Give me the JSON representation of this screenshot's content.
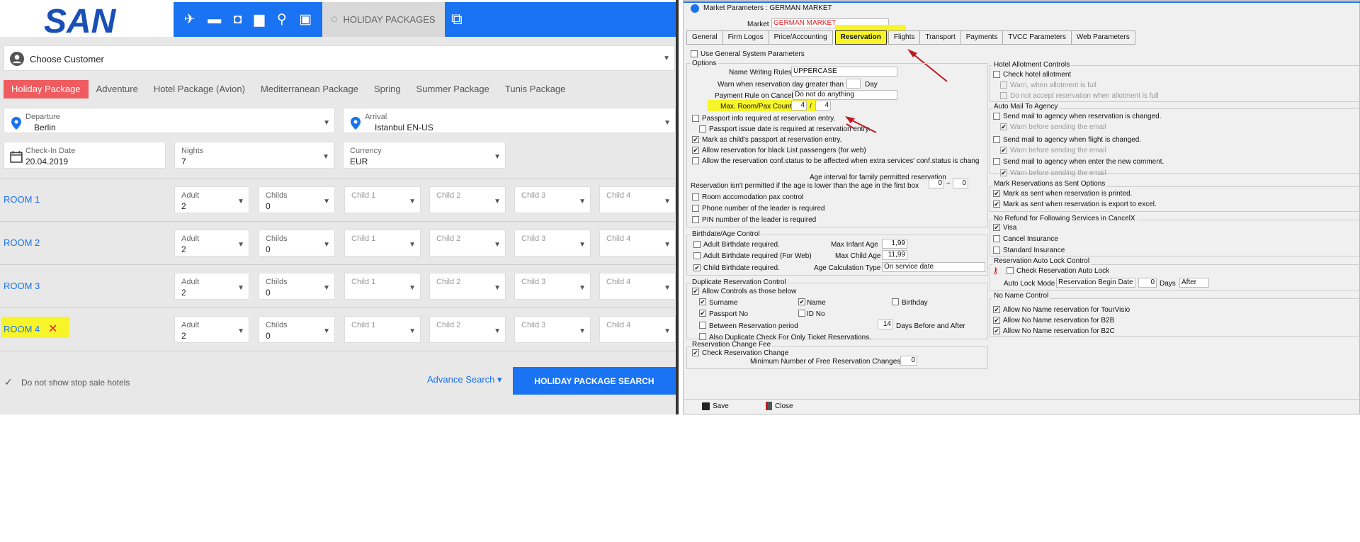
{
  "topnav": {
    "logo_text": "SAN",
    "icons": [
      "plane-icon",
      "bed-icon",
      "bag-icon",
      "car-icon",
      "person-walking-icon",
      "bus-icon"
    ],
    "package_tab_label": "HOLIDAY PACKAGES"
  },
  "customer": {
    "label": "Choose Customer"
  },
  "tabs": [
    "Holiday Package",
    "Adventure",
    "Hotel Package (Avion)",
    "Mediterranean Package",
    "Spring",
    "Summer Package",
    "Tunis Package"
  ],
  "departure": {
    "label": "Departure",
    "value": "Berlin"
  },
  "arrival": {
    "label": "Arrival",
    "value": "Istanbul EN-US"
  },
  "checkin": {
    "label": "Check-In Date",
    "value": "20.04.2019"
  },
  "nights": {
    "label": "Nights",
    "value": "7"
  },
  "currency": {
    "label": "Currency",
    "value": "EUR"
  },
  "rooms": [
    {
      "label": "ROOM 1",
      "adult": "2",
      "childs": "0"
    },
    {
      "label": "ROOM 2",
      "adult": "2",
      "childs": "0"
    },
    {
      "label": "ROOM 3",
      "adult": "2",
      "childs": "0"
    },
    {
      "label": "ROOM 4",
      "adult": "2",
      "childs": "0"
    }
  ],
  "room_field_labels": {
    "adult": "Adult",
    "childs": "Childs",
    "child1": "Child 1",
    "child2": "Child 2",
    "child3": "Child 3",
    "child4": "Child 4"
  },
  "stop_sale_label": "Do not show stop sale hotels",
  "advance_search_label": "Advance Search",
  "search_button_label": "HOLIDAY PACKAGE SEARCH",
  "dialog": {
    "title": "Market Parameters : GERMAN MARKET",
    "market_label": "Market",
    "market_value": "GERMAN MARKET",
    "tabs": [
      "General",
      "Firm Logos",
      "Price/Accounting",
      "Reservation",
      "Flights",
      "Transport",
      "Payments",
      "TVCC Parameters",
      "Web Parameters"
    ],
    "use_general": "Use General System Parameters",
    "options": {
      "title": "Options",
      "name_writing_rules_label": "Name Writing Rules",
      "name_writing_rules_value": "UPPERCASE",
      "warn_day_label": "Warn when reservation day greater than :",
      "warn_day_unit": "Day",
      "payment_rule_label": "Payment Rule on Cancel",
      "payment_rule_value": "Do not do anything",
      "max_room_label": "Max. Room/Pax Count",
      "max_room_value": "4",
      "max_pax_value": "4",
      "max_sep": "/",
      "passport_info": "Passport info required at reservation  entry.",
      "passport_issue": "Passport issue date is required at reservation  entry.",
      "child_passport": "Mark as child's passport at reservation  entry.",
      "black_list": "Allow reservation for black List passengers (for web)",
      "conf_status": "Allow the reservation conf.status to be affected when extra services' conf.status is chang",
      "age_interval_label": "Age interval for family permitted reservation",
      "age_interval_note": "Reservation isn't permitted if the age is lower than the age in the first box",
      "age_from": "0",
      "age_to": "0",
      "age_sep": "~",
      "room_accom": "Room accomodation pax control",
      "phone_leader": "Phone number of the leader is required",
      "pin_leader": "PIN number of the leader is required"
    },
    "birthdate": {
      "title": "Birthdate/Age Control",
      "adult_required": "Adult Birthdate required.",
      "adult_web": "Adult Birthdate required (For Web)",
      "child_required": "Child Birthdate required.",
      "max_infant_label": "Max Infant Age",
      "max_infant_value": "1,99",
      "max_child_label": "Max Child Age",
      "max_child_value": "11,99",
      "calc_type_label": "Age Calculation Type",
      "calc_type_value": "On service date"
    },
    "duplicate": {
      "title": "Duplicate Reservation Control",
      "allow_controls": "Allow Controls as those below",
      "surname": "Surname",
      "name": "Name",
      "birthday": "Birthday",
      "passport_no": "Passport No",
      "id_no": "ID No",
      "between": "Between Reservation period",
      "days_value": "14",
      "days_label": "Days Before and After",
      "also_dup": "Also Duplicate Check For Only Ticket Reservations."
    },
    "change_fee": {
      "title": "Reservation Change Fee",
      "check": "Check Reservation Change",
      "min_free_label": "Minimum Number of Free Reservation Changes",
      "min_free_value": "0"
    },
    "hotel_allot": {
      "title": "Hotel Allotment Controls",
      "check": "Check hotel allotment",
      "warn_full": "Warn, when allotment is full",
      "no_accept": "Do not accept reservation when allotment is full"
    },
    "auto_mail": {
      "title": "Auto Mail To Agency",
      "res_changed": "Send mail to agency when reservation is changed.",
      "warn1": "Warn before sending the email",
      "flight_changed": "Send mail to agency when flight is changed.",
      "warn2": "Warn before sending the email",
      "new_comment": "Send mail to agency when enter the new comment.",
      "warn3": "Warn before sending the email"
    },
    "mark_sent": {
      "title": "Mark Reservations as Sent Options",
      "printed": "Mark as sent when reservation is printed.",
      "excel": "Mark as sent when reservation is export to excel."
    },
    "no_refund": {
      "title": "No Refund for Following Services in CancelX",
      "visa": "Visa",
      "cancel_ins": "Cancel Insurance",
      "standard_ins": "Standard Insurance"
    },
    "auto_lock": {
      "title": "Reservation Auto Lock Control",
      "check": "Check Reservation Auto Lock",
      "mode_label": "Auto Lock Mode",
      "mode_value": "Reservation Begin Date",
      "days_value": "0",
      "days_label": "Days",
      "after_value": "After"
    },
    "no_name": {
      "title": "No Name Control",
      "tourvisio": "Allow No Name reservation for TourVisio",
      "b2b": "Allow No Name reservation for B2B",
      "b2c": "Allow No Name reservation for B2C"
    },
    "footer": {
      "save": "Save",
      "close": "Close"
    }
  }
}
